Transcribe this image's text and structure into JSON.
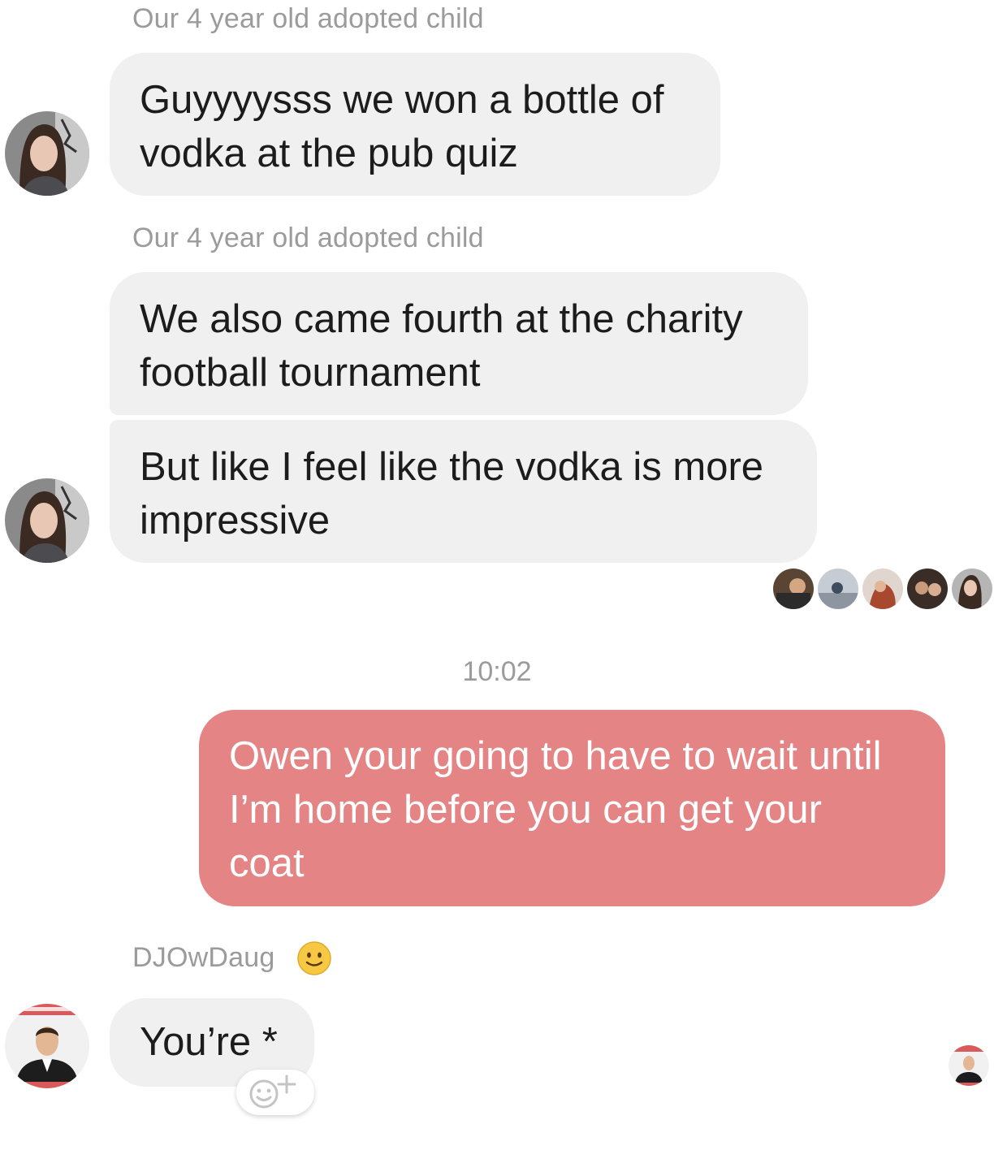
{
  "messages": [
    {
      "sender": "Our 4 year old adopted child",
      "lines": [
        "Guyyyysss we won a bottle of",
        "vodka at the pub quiz"
      ]
    },
    {
      "sender": "Our 4 year old adopted child",
      "lines": [
        "We also came fourth at the charity",
        "football tournament"
      ]
    },
    {
      "lines": [
        "But like I feel like the vodka is more",
        "impressive"
      ]
    },
    {
      "lines": [
        "Owen your going to have to wait until",
        "I’m home before you can get your",
        "coat"
      ]
    },
    {
      "sender": "DJOwDaug",
      "lines": [
        "You’re *"
      ]
    }
  ],
  "timestamp": "10:02",
  "icons": {
    "sender_status": "slightly-smiling-face-icon",
    "react": "add-reaction-icon"
  },
  "colors": {
    "incoming_bubble": "#f0f0f0",
    "outgoing_bubble": "#e58485",
    "meta_text": "#9b9b9b"
  }
}
